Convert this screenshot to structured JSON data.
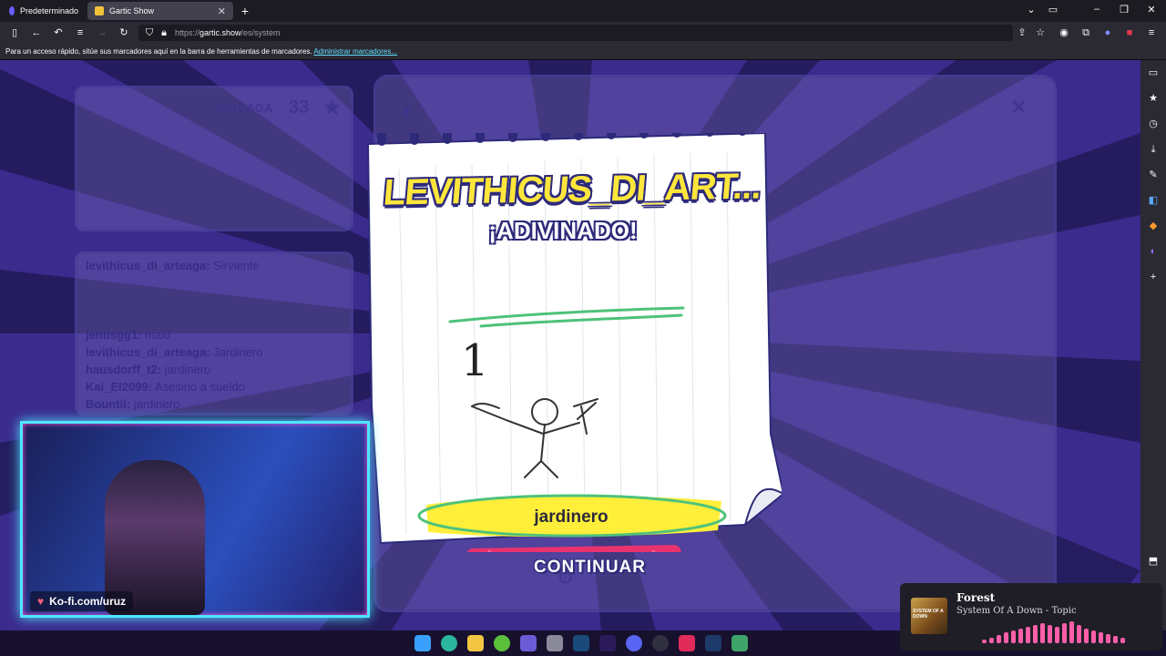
{
  "browser": {
    "tabs": [
      {
        "label": "Predeterminado",
        "active": false
      },
      {
        "label": "Gartic Show",
        "active": true
      }
    ],
    "url": {
      "prefix": "https://",
      "host": "gartic.show",
      "path": "/es/system"
    },
    "bookmarks_bar": {
      "text": "Para un acceso rápido, sitúe sus marcadores aquí en la barra de herramientas de marcadores.",
      "link": "Administrar marcadores..."
    }
  },
  "game": {
    "player_name": "LEVITHICUS_DI_ART...",
    "status": "¡ADIVINADO!",
    "drawing_number": "1",
    "answer": "jardinero",
    "continue_label": "CONTINUAR",
    "background_card": {
      "player": "ARTEAGA",
      "score": "33"
    },
    "chat": [
      {
        "user": "levithicus_di_arteaga:",
        "text": "Sirviente"
      },
      {
        "user": "jentisgg1:",
        "text": "maid"
      },
      {
        "user": "levithicus_di_arteaga:",
        "text": "Jardinero"
      },
      {
        "user": "hausdorff_t2:",
        "text": "jardinero"
      },
      {
        "user": "Kai_El2099:",
        "text": "Asesino a sueldo"
      },
      {
        "user": "Bountil:",
        "text": "jardinero"
      }
    ]
  },
  "webcam": {
    "kofi_label": "Ko-fi.com/uruz"
  },
  "music_widget": {
    "title": "Forest",
    "artist": "System Of A Down - Topic",
    "album_text": "SYSTEM OF A DOWN"
  },
  "colors": {
    "game_bg": "#3b2b8d",
    "ray": "#241c5e",
    "title_yellow": "#ffe63b",
    "button_pink": "#e8336f",
    "webcam_border": "#4ee6ff"
  }
}
